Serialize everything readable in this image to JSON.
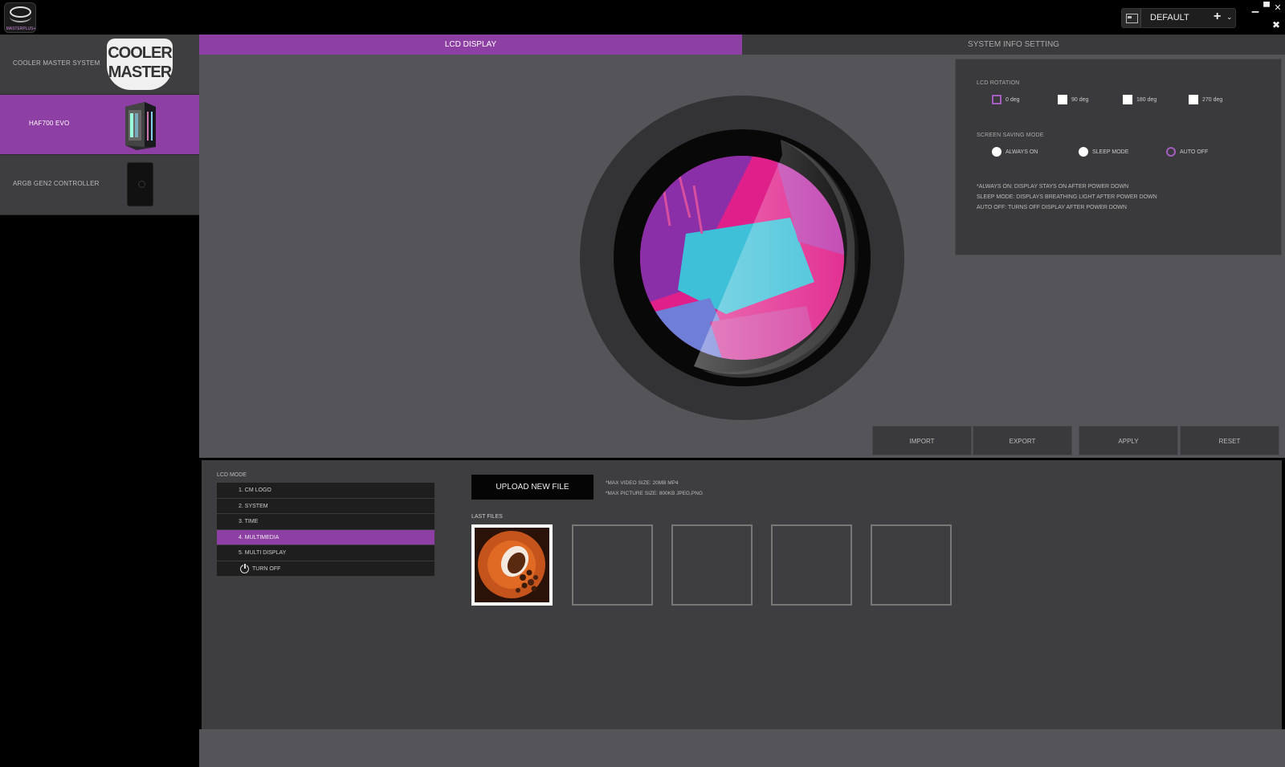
{
  "app": {
    "logo_text": "MASTERPLUS+",
    "profile": {
      "name": "DEFAULT",
      "add_icon": "plus-icon",
      "dropdown_icon": "chevron-down-icon"
    },
    "window": {
      "minimize": "▁",
      "maximize": "▀",
      "close": "✕",
      "extra": "✖"
    }
  },
  "sidebar": {
    "items": [
      {
        "label": "COOLER MASTER SYSTEM",
        "image": "COOLER MASTER"
      },
      {
        "label": "HAF700 EVO",
        "image": "case-image"
      },
      {
        "label": "ARGB GEN2 CONTROLLER",
        "image": "controller-image"
      }
    ],
    "logo_line1": "COOLER",
    "logo_line2": "MASTER"
  },
  "tabs": {
    "lcd": "LCD DISPLAY",
    "system": "SYSTEM INFO SETTING"
  },
  "settings": {
    "rotation_title": "LCD ROTATION",
    "rotations": [
      "0 deg",
      "90 deg",
      "180 deg",
      "270 deg"
    ],
    "rotation_selected": "0 deg",
    "saving_title": "SCREEN SAVING MODE",
    "saving_modes": [
      "ALWAYS ON",
      "SLEEP MODE",
      "AUTO OFF"
    ],
    "saving_selected": "AUTO OFF",
    "notes": [
      "*ALWAYS ON: DISPLAY STAYS ON AFTER POWER DOWN",
      "SLEEP MODE: DISPLAYS BREATHING LIGHT AFTER POWER DOWN",
      "AUTO OFF: TURNS OFF DISPLAY AFTER POWER DOWN"
    ]
  },
  "actions": {
    "import": "IMPORT",
    "export": "EXPORT",
    "apply": "APPLY",
    "reset": "RESET"
  },
  "lcd_mode": {
    "title": "LCD MODE",
    "items": [
      "1. CM LOGO",
      "2. SYSTEM",
      "3. TIME",
      "4. MULTIMEDIA",
      "5. MULTI DISPLAY",
      "TURN OFF"
    ],
    "selected": "4. MULTIMEDIA"
  },
  "upload": {
    "button": "UPLOAD NEW FILE",
    "note_video": "*MAX VIDEO SIZE: 20MB MP4",
    "note_picture": "*MAX PICTURE SIZE: 800KB JPEG,PNG"
  },
  "last_files": {
    "title": "LAST FILES",
    "count": 5
  },
  "colors": {
    "accent": "#8e3fa3",
    "panel": "#3a3a3c",
    "background": "#545459"
  }
}
